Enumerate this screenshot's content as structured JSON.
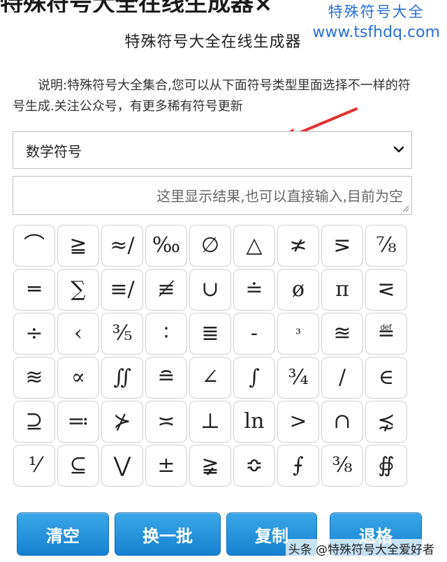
{
  "top_title": "特殊符号大全在线生成器×",
  "watermark": {
    "name": "特殊符号大全",
    "url": "www.tsfhdq.com"
  },
  "heading": "特殊符号大全在线生成器",
  "description": "说明:特殊符号大全集合,您可以从下面符号类型里面选择不一样的符号生成.关注公众号，有更多稀有符号更新",
  "category_select": {
    "selected": "数学符号"
  },
  "result_box": {
    "placeholder": "这里显示结果,也可以直接输入,目前为空"
  },
  "symbols": [
    "⌒",
    "≧",
    "≈/",
    "‰",
    "∅",
    "△",
    "≭",
    "⋝",
    "⅞",
    "═",
    "∑",
    "≡/",
    "≢",
    "∪",
    "≐",
    "ø",
    "π",
    "⋜",
    "÷",
    "‹",
    "⅗",
    "∶",
    "≣",
    "-",
    "³",
    "≊",
    "≝",
    "≋",
    "∝",
    "∬",
    "≘",
    "∠",
    "∫",
    "¾",
    "/",
    "∈",
    "⊇",
    "≕",
    "⊁",
    "≍",
    "⊥",
    "ln",
    ">",
    "∩",
    "⋨",
    "⅟",
    "⊆",
    "⋁",
    "±",
    "≩",
    "≎",
    "⨍",
    "⅜",
    "∯"
  ],
  "buttons": {
    "clear": "清空",
    "next_batch": "换一批",
    "copy": "复制",
    "backspace": "退格"
  },
  "footer": "头条 @特殊符号大全爱好者",
  "colors": {
    "button": "#1a8ad6",
    "watermark": "#2a6fd6",
    "arrow": "#e03030"
  }
}
